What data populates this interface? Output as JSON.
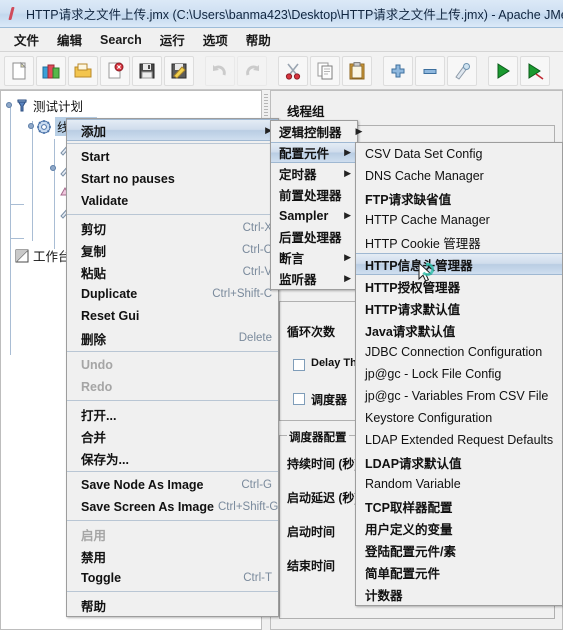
{
  "window": {
    "title": "HTTP请求之文件上传.jmx (C:\\Users\\banma423\\Desktop\\HTTP请求之文件上传.jmx) - Apache JMeter",
    "icon": "jmeter-icon"
  },
  "menubar": {
    "items": [
      {
        "label": "文件",
        "name": "menu-file"
      },
      {
        "label": "编辑",
        "name": "menu-edit"
      },
      {
        "label": "Search",
        "name": "menu-search"
      },
      {
        "label": "运行",
        "name": "menu-run"
      },
      {
        "label": "选项",
        "name": "menu-options"
      },
      {
        "label": "帮助",
        "name": "menu-help"
      }
    ]
  },
  "toolbar": {
    "buttons": [
      {
        "name": "new-button",
        "icon": "new-document-icon",
        "disabled": false
      },
      {
        "name": "templates-button",
        "icon": "templates-icon",
        "disabled": false
      },
      {
        "name": "open-button",
        "icon": "open-folder-icon",
        "disabled": false
      },
      {
        "name": "close-button",
        "icon": "close-document-icon",
        "disabled": false
      },
      {
        "name": "save-button",
        "icon": "save-floppy-icon",
        "disabled": false
      },
      {
        "name": "save-as-button",
        "icon": "save-as-icon",
        "disabled": false
      },
      {
        "name": "undo-button",
        "icon": "undo-arrow-icon",
        "disabled": true
      },
      {
        "name": "redo-button",
        "icon": "redo-arrow-icon",
        "disabled": true
      },
      {
        "name": "cut-button",
        "icon": "scissors-icon",
        "disabled": false
      },
      {
        "name": "copy-button",
        "icon": "copy-pages-icon",
        "disabled": false
      },
      {
        "name": "paste-button",
        "icon": "clipboard-icon",
        "disabled": false
      },
      {
        "name": "expand-all-button",
        "icon": "plus-icon",
        "disabled": false
      },
      {
        "name": "collapse-all-button",
        "icon": "minus-icon",
        "disabled": false
      },
      {
        "name": "toggle-button",
        "icon": "toggle-pencil-icon",
        "disabled": false
      },
      {
        "name": "start-button",
        "icon": "play-green-icon",
        "disabled": false
      },
      {
        "name": "start-no-pauses-button",
        "icon": "play-nopause-icon",
        "disabled": false
      }
    ]
  },
  "tree": {
    "nodes": [
      {
        "label": "测试计划",
        "icon": "test-plan-icon",
        "name": "tree-node-test-plan",
        "selected": false
      },
      {
        "label": "线程组",
        "icon": "thread-group-icon",
        "name": "tree-node-thread-group",
        "selected": true
      },
      {
        "label": "工作台",
        "icon": "workbench-icon",
        "name": "tree-node-workbench",
        "selected": false
      }
    ]
  },
  "right_panel": {
    "title": "线程组",
    "loop_count_label": "循环次数",
    "delay_thread_label": "Delay Thread creation until needed",
    "scheduler_label": "调度器",
    "scheduler_group_legend": "调度器配置",
    "duration_label": "持续时间 (秒)",
    "startup_delay_label": "启动延迟 (秒)",
    "start_time_label": "启动时间",
    "end_time_label": "结束时间"
  },
  "context_menu": {
    "name": "thread-group-context-menu",
    "items": [
      {
        "label": "添加",
        "accel": "",
        "submenu": true,
        "highlighted": true,
        "bold": true,
        "disabled": false,
        "name": "ctx-add"
      },
      {
        "separator": true
      },
      {
        "label": "Start",
        "accel": "",
        "submenu": false,
        "highlighted": false,
        "bold": true,
        "disabled": false,
        "name": "ctx-start"
      },
      {
        "label": "Start no pauses",
        "accel": "",
        "submenu": false,
        "highlighted": false,
        "bold": true,
        "disabled": false,
        "name": "ctx-start-no-pauses"
      },
      {
        "label": "Validate",
        "accel": "",
        "submenu": false,
        "highlighted": false,
        "bold": true,
        "disabled": false,
        "name": "ctx-validate"
      },
      {
        "separator": true
      },
      {
        "label": "剪切",
        "accel": "Ctrl-X",
        "submenu": false,
        "highlighted": false,
        "bold": true,
        "disabled": false,
        "name": "ctx-cut"
      },
      {
        "label": "复制",
        "accel": "Ctrl-C",
        "submenu": false,
        "highlighted": false,
        "bold": true,
        "disabled": false,
        "name": "ctx-copy"
      },
      {
        "label": "粘贴",
        "accel": "Ctrl-V",
        "submenu": false,
        "highlighted": false,
        "bold": true,
        "disabled": false,
        "name": "ctx-paste"
      },
      {
        "label": "Duplicate",
        "accel": "Ctrl+Shift-C",
        "submenu": false,
        "highlighted": false,
        "bold": true,
        "disabled": false,
        "name": "ctx-duplicate"
      },
      {
        "label": "Reset Gui",
        "accel": "",
        "submenu": false,
        "highlighted": false,
        "bold": true,
        "disabled": false,
        "name": "ctx-reset-gui"
      },
      {
        "label": "删除",
        "accel": "Delete",
        "submenu": false,
        "highlighted": false,
        "bold": true,
        "disabled": false,
        "name": "ctx-delete"
      },
      {
        "separator": true
      },
      {
        "label": "Undo",
        "accel": "",
        "submenu": false,
        "highlighted": false,
        "bold": true,
        "disabled": true,
        "name": "ctx-undo"
      },
      {
        "label": "Redo",
        "accel": "",
        "submenu": false,
        "highlighted": false,
        "bold": true,
        "disabled": true,
        "name": "ctx-redo"
      },
      {
        "separator": true
      },
      {
        "label": "打开...",
        "accel": "",
        "submenu": false,
        "highlighted": false,
        "bold": true,
        "disabled": false,
        "name": "ctx-open"
      },
      {
        "label": "合并",
        "accel": "",
        "submenu": false,
        "highlighted": false,
        "bold": true,
        "disabled": false,
        "name": "ctx-merge"
      },
      {
        "label": "保存为...",
        "accel": "",
        "submenu": false,
        "highlighted": false,
        "bold": true,
        "disabled": false,
        "name": "ctx-save-as"
      },
      {
        "separator": true
      },
      {
        "label": "Save Node As Image",
        "accel": "Ctrl-G",
        "submenu": false,
        "highlighted": false,
        "bold": true,
        "disabled": false,
        "name": "ctx-save-node-as-image"
      },
      {
        "label": "Save Screen As Image",
        "accel": "Ctrl+Shift-G",
        "submenu": false,
        "highlighted": false,
        "bold": true,
        "disabled": false,
        "name": "ctx-save-screen-as-image"
      },
      {
        "separator": true
      },
      {
        "label": "启用",
        "accel": "",
        "submenu": false,
        "highlighted": false,
        "bold": true,
        "disabled": true,
        "name": "ctx-enable"
      },
      {
        "label": "禁用",
        "accel": "",
        "submenu": false,
        "highlighted": false,
        "bold": true,
        "disabled": false,
        "name": "ctx-disable"
      },
      {
        "label": "Toggle",
        "accel": "Ctrl-T",
        "submenu": false,
        "highlighted": false,
        "bold": true,
        "disabled": false,
        "name": "ctx-toggle"
      },
      {
        "separator": true
      },
      {
        "label": "帮助",
        "accel": "",
        "submenu": false,
        "highlighted": false,
        "bold": true,
        "disabled": false,
        "name": "ctx-help"
      }
    ]
  },
  "add_submenu": {
    "name": "add-submenu",
    "items": [
      {
        "label": "逻辑控制器",
        "submenu": true,
        "highlighted": false,
        "name": "add-logic-controller"
      },
      {
        "label": "配置元件",
        "submenu": true,
        "highlighted": true,
        "name": "add-config-element"
      },
      {
        "label": "定时器",
        "submenu": true,
        "highlighted": false,
        "name": "add-timer"
      },
      {
        "label": "前置处理器",
        "submenu": true,
        "highlighted": false,
        "name": "add-pre-processor"
      },
      {
        "label": "Sampler",
        "submenu": true,
        "highlighted": false,
        "name": "add-sampler"
      },
      {
        "label": "后置处理器",
        "submenu": true,
        "highlighted": false,
        "name": "add-post-processor"
      },
      {
        "label": "断言",
        "submenu": true,
        "highlighted": false,
        "name": "add-assertion"
      },
      {
        "label": "监听器",
        "submenu": true,
        "highlighted": false,
        "name": "add-listener"
      }
    ]
  },
  "config_submenu": {
    "name": "config-element-submenu",
    "items": [
      {
        "label": "CSV Data Set Config",
        "highlighted": false,
        "bold": false,
        "name": "cfg-csv-data-set-config"
      },
      {
        "label": "DNS Cache Manager",
        "highlighted": false,
        "bold": false,
        "name": "cfg-dns-cache-manager"
      },
      {
        "label": "FTP请求缺省值",
        "highlighted": false,
        "bold": true,
        "name": "cfg-ftp-request-defaults"
      },
      {
        "label": "HTTP Cache Manager",
        "highlighted": false,
        "bold": false,
        "name": "cfg-http-cache-manager"
      },
      {
        "label": "HTTP Cookie 管理器",
        "highlighted": false,
        "bold": false,
        "name": "cfg-http-cookie-manager"
      },
      {
        "label": "HTTP信息头管理器",
        "highlighted": true,
        "bold": true,
        "name": "cfg-http-header-manager"
      },
      {
        "label": "HTTP授权管理器",
        "highlighted": false,
        "bold": true,
        "name": "cfg-http-authorization-manager"
      },
      {
        "label": "HTTP请求默认值",
        "highlighted": false,
        "bold": true,
        "name": "cfg-http-request-defaults"
      },
      {
        "label": "Java请求默认值",
        "highlighted": false,
        "bold": true,
        "name": "cfg-java-request-defaults"
      },
      {
        "label": "JDBC Connection Configuration",
        "highlighted": false,
        "bold": false,
        "name": "cfg-jdbc-connection-configuration"
      },
      {
        "label": "jp@gc - Lock File Config",
        "highlighted": false,
        "bold": false,
        "name": "cfg-jpgc-lock-file-config"
      },
      {
        "label": "jp@gc - Variables From CSV File",
        "highlighted": false,
        "bold": false,
        "name": "cfg-jpgc-variables-from-csv-file"
      },
      {
        "label": "Keystore Configuration",
        "highlighted": false,
        "bold": false,
        "name": "cfg-keystore-configuration"
      },
      {
        "label": "LDAP Extended Request Defaults",
        "highlighted": false,
        "bold": false,
        "name": "cfg-ldap-extended-request-defaults"
      },
      {
        "label": "LDAP请求默认值",
        "highlighted": false,
        "bold": true,
        "name": "cfg-ldap-request-defaults"
      },
      {
        "label": "Random Variable",
        "highlighted": false,
        "bold": false,
        "name": "cfg-random-variable"
      },
      {
        "label": "TCP取样器配置",
        "highlighted": false,
        "bold": true,
        "name": "cfg-tcp-sampler-config"
      },
      {
        "label": "用户定义的变量",
        "highlighted": false,
        "bold": true,
        "name": "cfg-user-defined-variables"
      },
      {
        "label": "登陆配置元件/素",
        "highlighted": false,
        "bold": true,
        "name": "cfg-login-config-element"
      },
      {
        "label": "简单配置元件",
        "highlighted": false,
        "bold": true,
        "name": "cfg-simple-config-element"
      },
      {
        "label": "计数器",
        "highlighted": false,
        "bold": true,
        "name": "cfg-counter"
      }
    ]
  },
  "colors": {
    "titlebar_gradient_top": "#dce9f7",
    "titlebar_gradient_bottom": "#c3d8ee",
    "menu_background": "#f0f0f0",
    "menu_highlight": "#b9cde3",
    "menu_border": "#9d9d9d",
    "accel_text": "#7a8a9c",
    "disabled_text": "#a5a5a5",
    "tree_selection": "#b8cfe5",
    "play_green": "#1a9a30"
  }
}
